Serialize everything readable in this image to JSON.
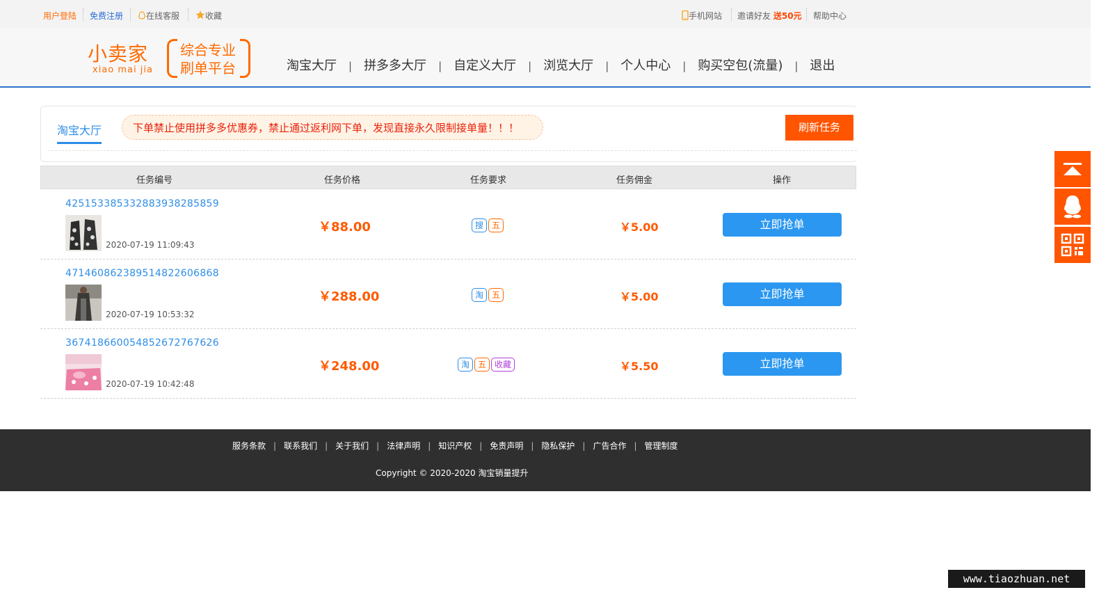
{
  "topbar": {
    "login": "用户登陆",
    "register": "免费注册",
    "customer_service": "在线客服",
    "favorite": "收藏",
    "mobile_site": "手机网站",
    "invite_prefix": "邀请好友",
    "invite_bonus": "送50元",
    "help": "帮助中心"
  },
  "logo": {
    "name": "小卖家",
    "pinyin": "xiao mai jia",
    "slogan_line1": "综合专业",
    "slogan_line2": "刷单平台"
  },
  "nav": [
    "淘宝大厅",
    "拼多多大厅",
    "自定义大厅",
    "浏览大厅",
    "个人中心",
    "购买空包(流量)",
    "退出"
  ],
  "panel": {
    "active_tab": "淘宝大厅",
    "notice": "下单禁止使用拼多多优惠券，禁止通过返利网下单，发现直接永久限制接单量！！！",
    "refresh_button": "刷新任务"
  },
  "table": {
    "headers": [
      "任务编号",
      "任务价格",
      "任务要求",
      "任务佣金",
      "操作"
    ],
    "rows": [
      {
        "id": "4251533853328839382858 59",
        "date": "2020-07-19 11:09:43",
        "price": "￥88.00",
        "tags": [
          {
            "text": "搜",
            "color": "blue"
          },
          {
            "text": "五",
            "color": "orange"
          }
        ],
        "commission": "￥5.00",
        "action": "立即抢单",
        "thumb": "dress-photo"
      },
      {
        "id": "4714608623895148226068 68",
        "date": "2020-07-19 10:53:32",
        "price": "￥288.00",
        "tags": [
          {
            "text": "淘",
            "color": "blue"
          },
          {
            "text": "五",
            "color": "orange"
          }
        ],
        "commission": "￥5.00",
        "action": "立即抢单",
        "thumb": "coat-photo"
      },
      {
        "id": "3674186600548526727676 26",
        "date": "2020-07-19 10:42:48",
        "price": "￥248.00",
        "tags": [
          {
            "text": "淘",
            "color": "blue"
          },
          {
            "text": "五",
            "color": "orange"
          },
          {
            "text": "收藏",
            "color": "purple"
          }
        ],
        "commission": "￥5.50",
        "action": "立即抢单",
        "thumb": "bedding-photo"
      }
    ]
  },
  "footer": {
    "links": [
      "服务条款",
      "联系我们",
      "关于我们",
      "法律声明",
      "知识产权",
      "免责声明",
      "隐私保护",
      "广告合作",
      "管理制度"
    ],
    "copyright": "Copyright © 2020-2020 淘宝销量提升"
  },
  "side_buttons": [
    "back-to-top-icon",
    "qq-icon",
    "qrcode-icon"
  ],
  "watermark": "www.tiaozhuan.net",
  "colors": {
    "accent_orange": "#ff5500",
    "link_blue": "#2e8ee6",
    "button_blue": "#2b97f0",
    "header_line": "#2e74c9",
    "footer_bg": "#2f2f2f"
  }
}
